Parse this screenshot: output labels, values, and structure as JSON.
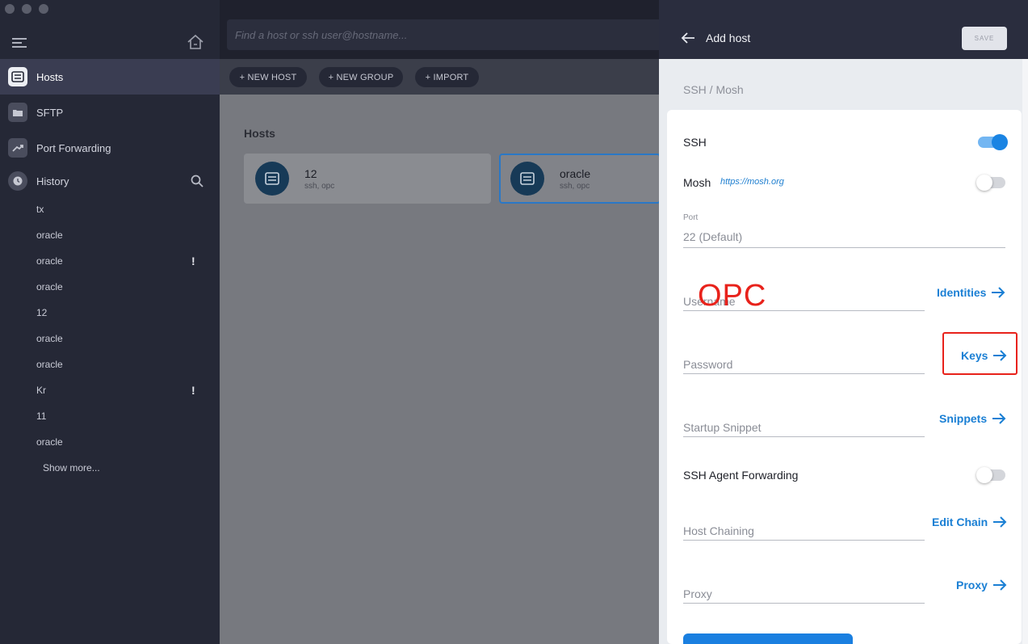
{
  "sidebar": {
    "nav": [
      {
        "label": "Hosts",
        "icon": "hosts-icon"
      },
      {
        "label": "SFTP",
        "icon": "folder-icon"
      },
      {
        "label": "Port Forwarding",
        "icon": "port-forwarding-icon"
      },
      {
        "label": "History",
        "icon": "history-icon"
      }
    ],
    "history": [
      "tx",
      "oracle",
      "oracle",
      "oracle",
      "12",
      "oracle",
      "oracle",
      "Kr",
      "11",
      "oracle"
    ],
    "warning_mark": "!",
    "show_more": "Show more..."
  },
  "search": {
    "placeholder": "Find a host or ssh user@hostname..."
  },
  "toolbar": {
    "new_host": "+ NEW HOST",
    "new_group": "+ NEW GROUP",
    "import": "+ IMPORT"
  },
  "main": {
    "section_title": "Hosts",
    "hosts": [
      {
        "name": "12",
        "sub": "ssh, opc"
      },
      {
        "name": "oracle",
        "sub": "ssh, opc"
      }
    ]
  },
  "panel": {
    "title": "Add host",
    "save": "SAVE",
    "section": "SSH / Mosh",
    "ssh_label": "SSH",
    "ssh_enabled": true,
    "mosh_label": "Mosh",
    "mosh_link": "https://mosh.org",
    "mosh_enabled": false,
    "port_label": "Port",
    "port_value": "22 (Default)",
    "username_placeholder": "Username",
    "identities": "Identities",
    "password_placeholder": "Password",
    "keys": "Keys",
    "startup_snippet_placeholder": "Startup Snippet",
    "snippets": "Snippets",
    "agent_forwarding_label": "SSH Agent Forwarding",
    "agent_forwarding_enabled": false,
    "host_chaining_placeholder": "Host Chaining",
    "edit_chain": "Edit Chain",
    "proxy_placeholder": "Proxy",
    "proxy": "Proxy"
  },
  "annotation": {
    "text": "OPC",
    "color": "#e8221b"
  },
  "colors": {
    "accent": "#1a7fd4",
    "sidebar": "#252836",
    "header": "#2a2d3e"
  }
}
